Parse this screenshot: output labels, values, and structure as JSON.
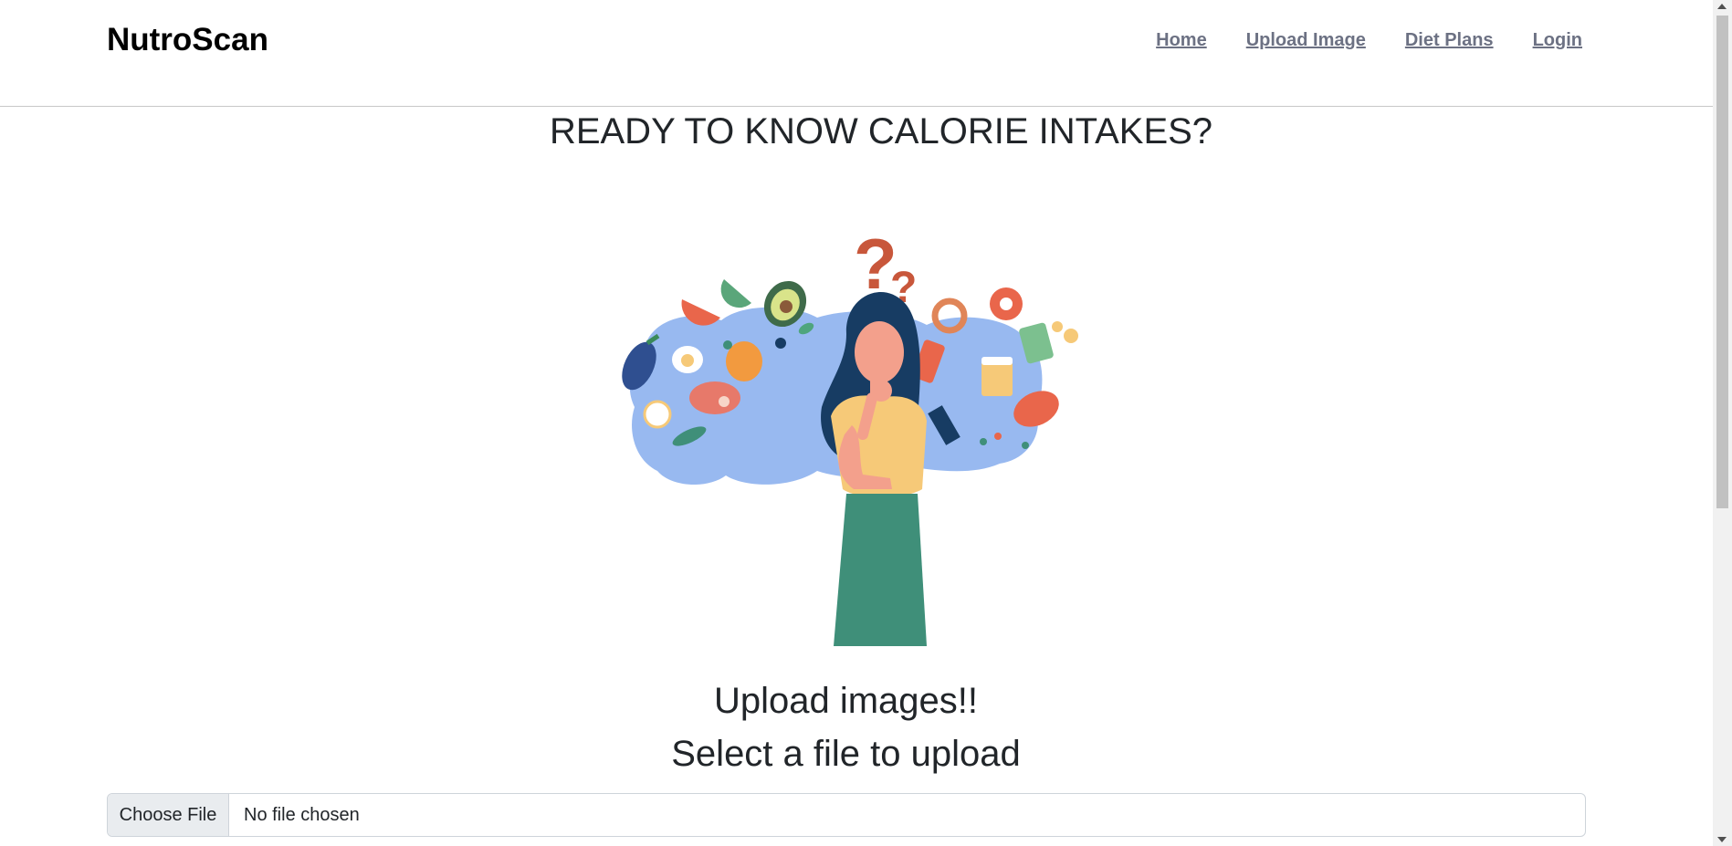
{
  "app": {
    "brand": "NutroScan"
  },
  "nav": {
    "links": [
      {
        "label": "Home"
      },
      {
        "label": "Upload Image"
      },
      {
        "label": "Diet Plans"
      },
      {
        "label": "Login"
      }
    ]
  },
  "main": {
    "headline": "READY TO KNOW CALORIE INTAKES?",
    "hero_image": "woman-thinking-about-food-illustration",
    "upload_title": "Upload images!!",
    "upload_subtitle": "Select a file to upload"
  },
  "file_input": {
    "button_label": "Choose File",
    "status_text": "No file chosen"
  },
  "colors": {
    "nav_link": "#6c7183",
    "brand": "#000000",
    "file_button_bg": "#e9ecef",
    "illustration_bg": "#98b9f0",
    "hair": "#173c63",
    "shirt": "#f6c978",
    "skirt": "#3f8f79",
    "skin": "#f3a08c"
  }
}
